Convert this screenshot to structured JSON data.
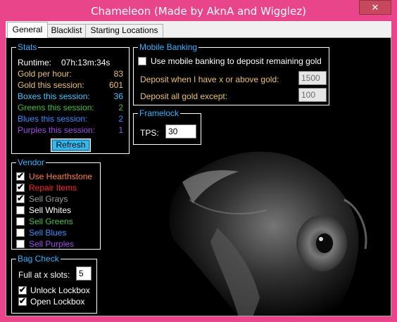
{
  "window": {
    "title": "Chameleon (Made by AknA and Wigglez)",
    "close_glyph": "✕"
  },
  "tabs": [
    {
      "label": "General"
    },
    {
      "label": "Blacklist"
    },
    {
      "label": "Starting Locations"
    }
  ],
  "stats": {
    "group_title": "Stats",
    "runtime_label": "Runtime:",
    "runtime_value": "07h:13m:34s",
    "rows": [
      {
        "label": "Gold per hour:",
        "value": "83",
        "color": "#e8c36a"
      },
      {
        "label": "Gold this session:",
        "value": "601",
        "color": "#e8c36a"
      },
      {
        "label": "Boxes this session:",
        "value": "36",
        "color": "#3fc8ff"
      },
      {
        "label": "Greens this session:",
        "value": "2",
        "color": "#40c23c"
      },
      {
        "label": "Blues this session:",
        "value": "2",
        "color": "#3a8cff"
      },
      {
        "label": "Purples this session:",
        "value": "1",
        "color": "#9a4fe8"
      }
    ],
    "refresh_label": "Refresh"
  },
  "mobile_banking": {
    "group_title": "Mobile Banking",
    "use_label": "Use mobile banking to deposit remaining gold",
    "use_checked": false,
    "deposit_when_label": "Deposit when I have x or above gold:",
    "deposit_when_value": "1500",
    "deposit_except_label": "Deposit all gold except:",
    "deposit_except_value": "100",
    "label_color": "#e8c36a"
  },
  "framelock": {
    "group_title": "Framelock",
    "tps_label": "TPS:",
    "tps_value": "30"
  },
  "vendor": {
    "group_title": "Vendor",
    "items": [
      {
        "label": "Use Hearthstone",
        "checked": true,
        "color": "#ff7d3f"
      },
      {
        "label": "Repair Items",
        "checked": true,
        "color": "#ff2020"
      },
      {
        "label": "Sell Grays",
        "checked": true,
        "color": "#9b9b9b"
      },
      {
        "label": "Sell Whites",
        "checked": false,
        "color": "#ffffff"
      },
      {
        "label": "Sell Greens",
        "checked": false,
        "color": "#40c23c"
      },
      {
        "label": "Sell Blues",
        "checked": false,
        "color": "#3a8cff"
      },
      {
        "label": "Sell Purples",
        "checked": false,
        "color": "#9a4fe8"
      }
    ]
  },
  "bag_check": {
    "group_title": "Bag Check",
    "full_label": "Full at x slots:",
    "full_value": "5",
    "unlock_label": "Unlock Lockbox",
    "unlock_checked": true,
    "open_label": "Open Lockbox",
    "open_checked": true
  },
  "colors": {
    "window_accent": "#e8458a",
    "group_title": "#30b3ff",
    "refresh_button": "#2fbbf1"
  }
}
